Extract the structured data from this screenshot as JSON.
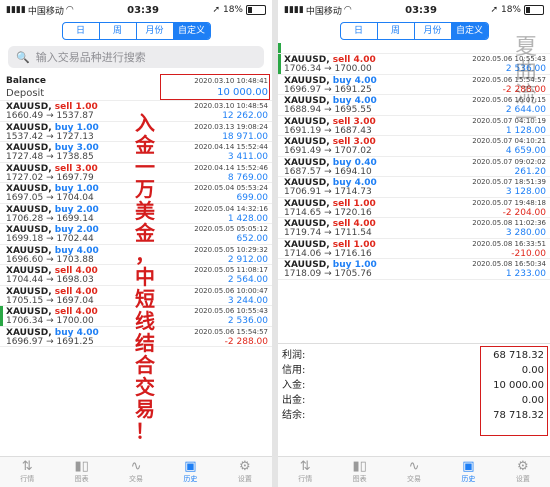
{
  "status": {
    "carrier": "中国移动",
    "time": "03:39",
    "battery": "18%"
  },
  "tabs": [
    "日",
    "周",
    "月份",
    "自定义"
  ],
  "active_tab": 3,
  "search_placeholder": "输入交易品种进行搜索",
  "balance": {
    "label": "Balance",
    "sub": "Deposit",
    "date": "2020.03.10 10:48:41",
    "amount": "10 000.00"
  },
  "left_trades": [
    {
      "symbol": "XAUUSD,",
      "side": "sell",
      "lots": "1.00",
      "prices": "1660.49 → 1537.87",
      "date": "2020.03.10 10:48:54",
      "profit": "12 262.00",
      "bar": false
    },
    {
      "symbol": "XAUUSD,",
      "side": "buy",
      "lots": "1.00",
      "prices": "1537.42 → 1727.13",
      "date": "2020.03.13 19:08:24",
      "profit": "18 971.00",
      "bar": false
    },
    {
      "symbol": "XAUUSD,",
      "side": "buy",
      "lots": "3.00",
      "prices": "1727.48 → 1738.85",
      "date": "2020.04.14 15:52:44",
      "profit": "3 411.00",
      "bar": false
    },
    {
      "symbol": "XAUUSD,",
      "side": "sell",
      "lots": "3.00",
      "prices": "1727.02 → 1697.79",
      "date": "2020.04.14 15:52:46",
      "profit": "8 769.00",
      "bar": false
    },
    {
      "symbol": "XAUUSD,",
      "side": "buy",
      "lots": "1.00",
      "prices": "1697.05 → 1704.04",
      "date": "2020.05.04 05:53:24",
      "profit": "699.00",
      "bar": false
    },
    {
      "symbol": "XAUUSD,",
      "side": "buy",
      "lots": "2.00",
      "prices": "1706.28 → 1699.14",
      "date": "2020.05.04 14:32:16",
      "profit": "1 428.00",
      "bar": false
    },
    {
      "symbol": "XAUUSD,",
      "side": "buy",
      "lots": "2.00",
      "prices": "1699.18 → 1702.44",
      "date": "2020.05.05 05:05:12",
      "profit": "652.00",
      "bar": false
    },
    {
      "symbol": "XAUUSD,",
      "side": "buy",
      "lots": "4.00",
      "prices": "1696.60 → 1703.88",
      "date": "2020.05.05 10:29:32",
      "profit": "2 912.00",
      "bar": false
    },
    {
      "symbol": "XAUUSD,",
      "side": "sell",
      "lots": "4.00",
      "prices": "1704.44 → 1698.03",
      "date": "2020.05.05 11:08:17",
      "profit": "2 564.00",
      "bar": false
    },
    {
      "symbol": "XAUUSD,",
      "side": "sell",
      "lots": "4.00",
      "prices": "1705.15 → 1697.04",
      "date": "2020.05.06 10:00:47",
      "profit": "3 244.00",
      "bar": false
    },
    {
      "symbol": "XAUUSD,",
      "side": "sell",
      "lots": "4.00",
      "prices": "1706.34 → 1700.00",
      "date": "2020.05.06 10:55:43",
      "profit": "2 536.00",
      "bar": true
    },
    {
      "symbol": "XAUUSD,",
      "side": "buy",
      "lots": "4.00",
      "prices": "1696.97 → 1691.25",
      "date": "2020.05.06 15:54:57",
      "profit": "-2 288.00",
      "bar": false
    }
  ],
  "right_trades": [
    {
      "symbol": "",
      "side": "",
      "lots": "",
      "prices": "",
      "date": "",
      "profit": "",
      "bar": true
    },
    {
      "symbol": "XAUUSD,",
      "side": "sell",
      "lots": "4.00",
      "prices": "1706.34 → 1700.00",
      "date": "2020.05.06 10:55:43",
      "profit": "2 536.00",
      "bar": true
    },
    {
      "symbol": "XAUUSD,",
      "side": "buy",
      "lots": "4.00",
      "prices": "1696.97 → 1691.25",
      "date": "2020.05.06 15:54:57",
      "profit": "-2 288.00",
      "bar": false
    },
    {
      "symbol": "XAUUSD,",
      "side": "buy",
      "lots": "4.00",
      "prices": "1688.94 → 1695.55",
      "date": "2020.05.06 16:07:15",
      "profit": "2 644.00",
      "bar": false
    },
    {
      "symbol": "XAUUSD,",
      "side": "sell",
      "lots": "3.00",
      "prices": "1691.19 → 1687.43",
      "date": "2020.05.07 04:10:19",
      "profit": "1 128.00",
      "bar": false
    },
    {
      "symbol": "XAUUSD,",
      "side": "sell",
      "lots": "3.00",
      "prices": "1691.49 → 1707.02",
      "date": "2020.05.07 04:10:21",
      "profit": "4 659.00",
      "bar": false
    },
    {
      "symbol": "XAUUSD,",
      "side": "buy",
      "lots": "0.40",
      "prices": "1687.57 → 1694.10",
      "date": "2020.05.07 09:02:02",
      "profit": "261.20",
      "bar": false
    },
    {
      "symbol": "XAUUSD,",
      "side": "buy",
      "lots": "4.00",
      "prices": "1706.91 → 1714.73",
      "date": "2020.05.07 18:51:39",
      "profit": "3 128.00",
      "bar": false
    },
    {
      "symbol": "XAUUSD,",
      "side": "sell",
      "lots": "1.00",
      "prices": "1714.65 → 1720.16",
      "date": "2020.05.07 19:48:18",
      "profit": "-2 204.00",
      "bar": false
    },
    {
      "symbol": "XAUUSD,",
      "side": "sell",
      "lots": "4.00",
      "prices": "1719.74 → 1711.54",
      "date": "2020.05.08 11:02:36",
      "profit": "3 280.00",
      "bar": false
    },
    {
      "symbol": "XAUUSD,",
      "side": "sell",
      "lots": "1.00",
      "prices": "1714.06 → 1716.16",
      "date": "2020.05.08 16:33:51",
      "profit": "-210.00",
      "bar": false
    },
    {
      "symbol": "XAUUSD,",
      "side": "buy",
      "lots": "1.00",
      "prices": "1718.09 → 1705.76",
      "date": "2020.05.08 16:50:34",
      "profit": "1 233.00",
      "bar": false
    }
  ],
  "summary": [
    {
      "label": "利润:",
      "value": "68 718.32"
    },
    {
      "label": "信用:",
      "value": "0.00"
    },
    {
      "label": "入金:",
      "value": "10 000.00"
    },
    {
      "label": "出金:",
      "value": "0.00"
    },
    {
      "label": "结余:",
      "value": "78 718.32"
    }
  ],
  "tabbar": [
    {
      "label": "行情",
      "icon": "quotes-icon"
    },
    {
      "label": "图表",
      "icon": "chart-icon"
    },
    {
      "label": "交易",
      "icon": "trade-icon"
    },
    {
      "label": "历史",
      "icon": "history-icon"
    },
    {
      "label": "设置",
      "icon": "settings-icon"
    }
  ],
  "overlay_text": "入金一万美金，中短线结合交易！",
  "watermark": "夏曲流一"
}
